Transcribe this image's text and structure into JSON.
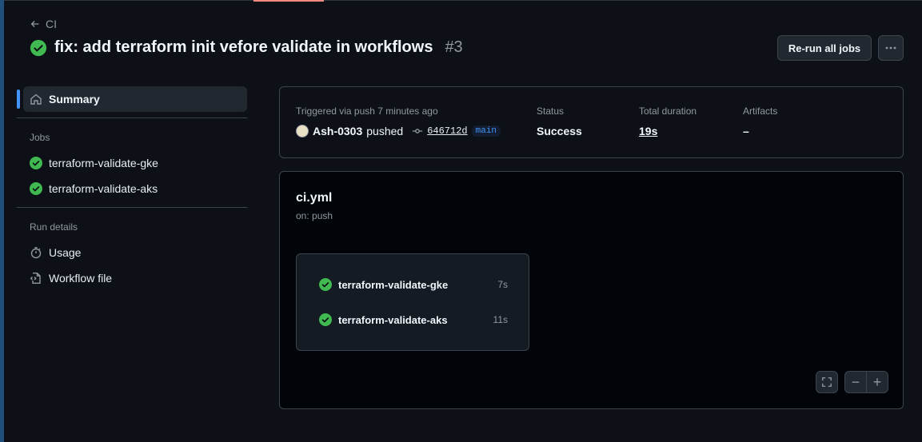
{
  "header": {
    "back_label": "CI",
    "title": "fix: add terraform init vefore validate in workflows",
    "run_number": "#3",
    "rerun_label": "Re-run all jobs"
  },
  "sidebar": {
    "summary_label": "Summary",
    "jobs_heading": "Jobs",
    "jobs": [
      {
        "label": "terraform-validate-gke"
      },
      {
        "label": "terraform-validate-aks"
      }
    ],
    "run_details_heading": "Run details",
    "usage_label": "Usage",
    "workflow_file_label": "Workflow file"
  },
  "summary": {
    "trigger_text": "Triggered via push 7 minutes ago",
    "actor": "Ash-0303",
    "action": "pushed",
    "commit_sha": "646712d",
    "branch": "main",
    "status_label": "Status",
    "status_value": "Success",
    "duration_label": "Total duration",
    "duration_value": "19s",
    "artifacts_label": "Artifacts",
    "artifacts_value": "–"
  },
  "workflow": {
    "file_name": "ci.yml",
    "trigger": "on: push",
    "jobs": [
      {
        "name": "terraform-validate-gke",
        "duration": "7s"
      },
      {
        "name": "terraform-validate-aks",
        "duration": "11s"
      }
    ]
  },
  "colors": {
    "success": "#3fb950",
    "accent": "#4493f8",
    "background": "#0d1117"
  }
}
